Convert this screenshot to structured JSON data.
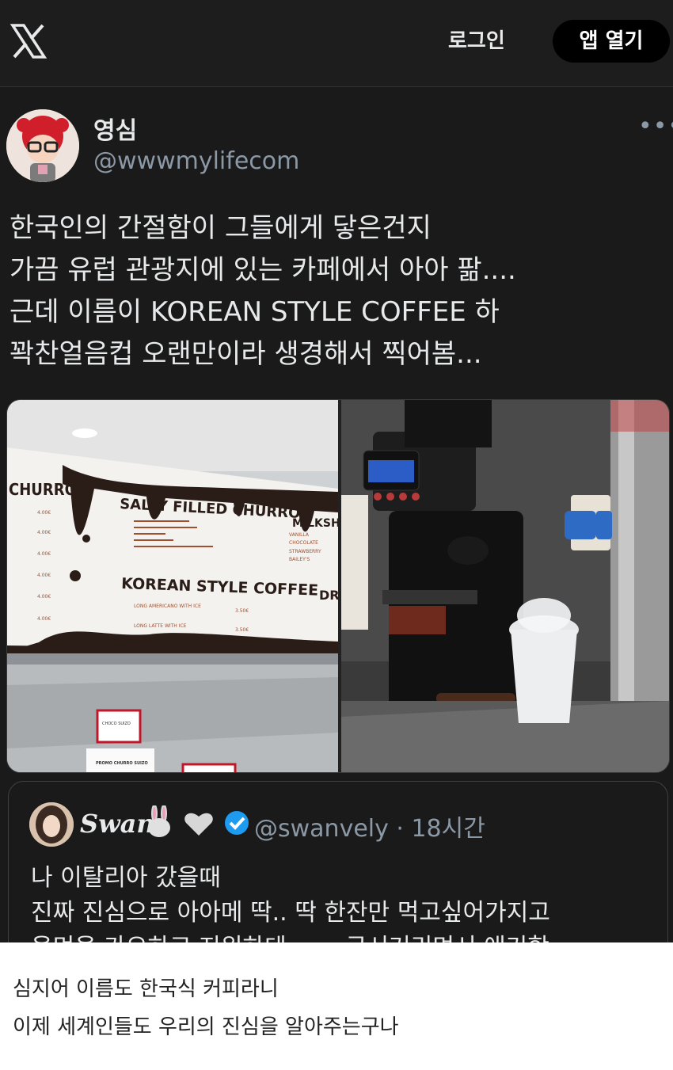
{
  "header": {
    "login_label": "로그인",
    "open_app_label": "앱 열기"
  },
  "author": {
    "display_name": "영심",
    "handle": "@wwwmylifecom"
  },
  "tweet": {
    "lines": [
      "한국인의 간절함이 그들에게 닿은건지",
      "가끔 유럽 관광지에 있는 카페에서 아아 팖....",
      "근데 이름이 KOREAN STYLE COFFEE 하",
      "꽉찬얼음컵 오랜만이라 생경해서 찍어봄..."
    ]
  },
  "menu_board": {
    "left_title": "CHURROS",
    "main_title": "SALTY FILLED CHURROS",
    "right_title": "MILKSH",
    "section": "KOREAN STYLE COFFEE",
    "items": [
      "LONG AMERICANO WITH ICE",
      "LONG LATTE WITH ICE"
    ],
    "prices": [
      "3.50€",
      "3.50€"
    ],
    "left_prices": [
      "4.00€",
      "4.00€",
      "4.00€",
      "4.00€",
      "4.00€",
      "4.00€"
    ],
    "right_items": [
      "VANILLA",
      "CHOCOLATE",
      "STRAWBERRY",
      "BAILEY'S"
    ],
    "drinks_title": "DRI",
    "sign1": "CHOCO SUIZO",
    "sign2": "PROMO CHURRO SUIZO"
  },
  "quote": {
    "name": "Swan",
    "handle_time": "@swanvely · 18시간",
    "lines": [
      "나 이탈리아 갔을때",
      "진짜 진심으로 아아메 딱.. 딱 한잔만 먹고싶어가지고",
      "용먼을 가오하고 지워하데 ㅜㅜ 구시거리며서 애기함ㅠ"
    ]
  },
  "captions": [
    "심지어 이름도 한국식 커피라니",
    "이제 세계인들도 우리의 진심을 알아주는구나"
  ],
  "colors": {
    "background": "#1a1a1a",
    "secondary_text": "#8b98a5",
    "verified": "#1d9bf0"
  }
}
